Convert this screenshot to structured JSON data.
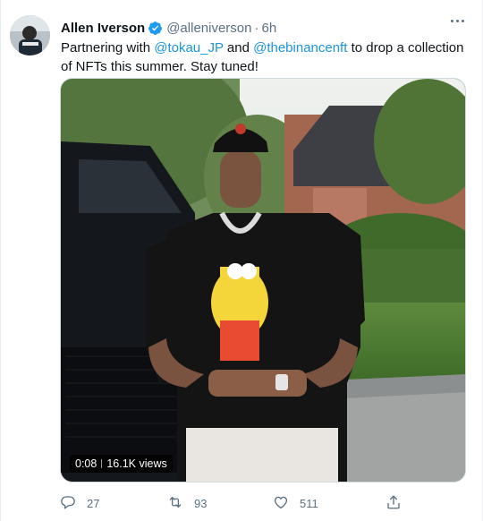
{
  "tweet": {
    "author_name": "Allen Iverson",
    "handle": "@alleniverson",
    "separator": "·",
    "time": "6h",
    "text_before": "Partnering with ",
    "mention_1": "@tokau_JP",
    "text_middle": " and ",
    "mention_2": "@thebinancenft",
    "text_after": " to drop a collection of NFTs this summer. Stay tuned!",
    "verified_icon": "verified-badge-icon",
    "accent_color": "#1b95e0"
  },
  "video": {
    "duration": "0:08",
    "views": "16.1K views"
  },
  "actions": {
    "replies": "27",
    "retweets": "93",
    "likes": "511"
  },
  "icons": [
    "more-options-icon",
    "reply-icon",
    "retweet-icon",
    "like-icon",
    "share-icon"
  ]
}
